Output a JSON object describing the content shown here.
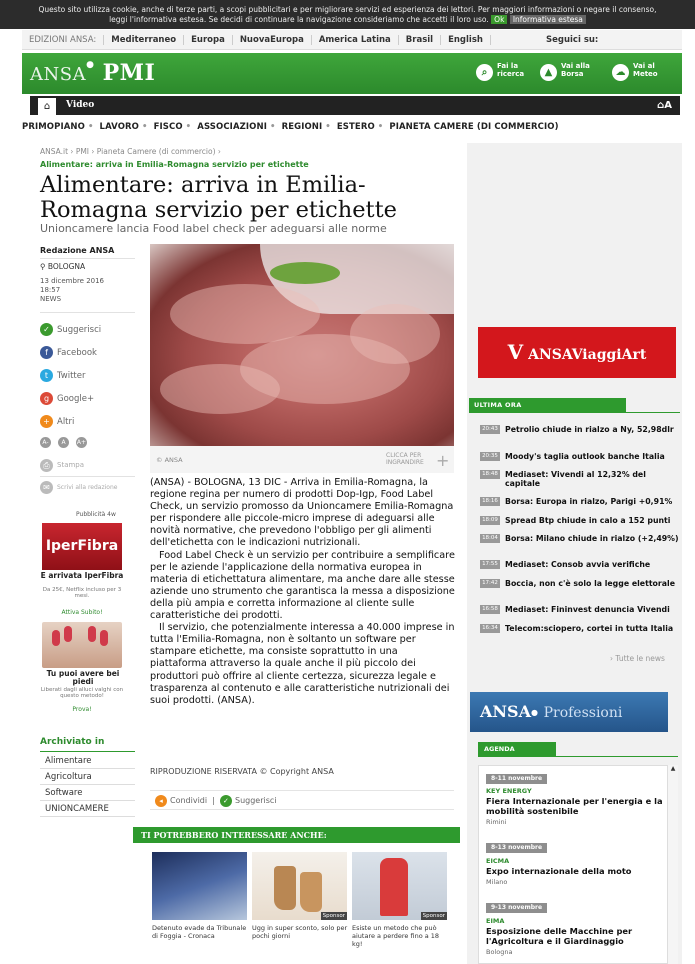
{
  "cookie": {
    "line1": "Questo sito utilizza cookie, anche di terze parti, a scopi pubblicitari e per migliorare servizi ed esperienza dei lettori. Per maggiori informazioni o negare il consenso,",
    "line2": "leggi l'informativa estesa. Se decidi di continuare la navigazione consideriamo che accetti il loro uso.",
    "ok": "Ok",
    "info": "Informativa estesa"
  },
  "editions": {
    "label": "EDIZIONI ANSA:",
    "items": [
      "Mediterraneo",
      "Europa",
      "NuovaEuropa",
      "America Latina",
      "Brasil",
      "English"
    ],
    "follow": "Seguici su:"
  },
  "header": {
    "logo_prefix": "ANSA",
    "logo_main": "PMI",
    "buttons": [
      {
        "icon": "search-icon",
        "label": "Fai la ricerca"
      },
      {
        "icon": "chart-icon",
        "label": "Vai alla Borsa"
      },
      {
        "icon": "weather-icon",
        "label": "Vai al Meteo"
      }
    ]
  },
  "nav": {
    "video": "Video",
    "font_size": "A"
  },
  "sections": [
    "PRIMOPIANO",
    "LAVORO",
    "FISCO",
    "ASSOCIAZIONI",
    "REGIONI",
    "ESTERO",
    "PIANETA CAMERE (DI COMMERCIO)"
  ],
  "article": {
    "breadcrumb": "ANSA.it › PMI › Pianeta Camere (di commercio) ›",
    "kicker": "Alimentare: arriva in Emilia-Romagna servizio per etichette",
    "title": "Alimentare: arriva in Emilia-Romagna servizio per etichette",
    "subtitle": "Unioncamere lancia Food label check per adeguarsi alle norme",
    "author": "Redazione ANSA",
    "location": "BOLOGNA",
    "date": "13 dicembre 2016",
    "time": "18:57",
    "type": "NEWS",
    "photo_credit": "© ANSA",
    "photo_enlarge": "CLICCA PER INGRANDIRE",
    "paragraphs": [
      "(ANSA) - BOLOGNA, 13 DIC - Arriva in Emilia-Romagna, la regione regina per numero di prodotti Dop-Igp, Food Label Check, un servizio promosso da Unioncamere Emilia-Romagna per rispondere alle piccole-micro imprese di adeguarsi alle novità normative, che prevedono l'obbligo per gli alimenti dell'etichetta con le indicazioni nutrizionali.",
      "Food Label Check è un servizio per contribuire a semplificare per le aziende l'applicazione della normativa europea in materia di etichettatura alimentare, ma anche dare alle stesse aziende uno strumento che garantisca la messa a disposizione della più ampia e corretta informazione al cliente sulle caratteristiche dei prodotti.",
      "Il servizio, che potenzialmente interessa a 40.000 imprese in tutta l'Emilia-Romagna, non è soltanto un software per stampare etichette, ma consiste soprattutto in una piattaforma attraverso la quale anche il più piccolo dei produttori può offrire al cliente certezza, sicurezza legale e trasparenza al contenuto e alle caratteristiche nutrizionali dei suoi prodotti. (ANSA)."
    ],
    "rights": "RIPRODUZIONE RISERVATA © Copyright ANSA",
    "share_label": "Condividi",
    "suggest_label": "Suggerisci"
  },
  "share": {
    "items": [
      {
        "icon": "suggest-icon",
        "label": "Suggerisci",
        "color": "#3b9a2e"
      },
      {
        "icon": "facebook-icon",
        "label": "Facebook",
        "color": "#3b5998"
      },
      {
        "icon": "twitter-icon",
        "label": "Twitter",
        "color": "#2aa9e0"
      },
      {
        "icon": "googleplus-icon",
        "label": "Google+",
        "color": "#dc4a38"
      },
      {
        "icon": "more-icon",
        "label": "Altri",
        "color": "#f08a1c"
      }
    ],
    "font_sizes": [
      "A-",
      "A",
      "A+"
    ],
    "print": "Stampa",
    "write": "Scrivi alla redazione"
  },
  "ads": {
    "label": "Pubblicità 4w",
    "ad1_brand": "IperFibra",
    "ad1_title": "E arrivata IperFibra",
    "ad1_sub": "Da 25€, Netflix incluso per 3 mesi.",
    "ad1_link": "Attiva Subito!",
    "ad2_title": "Tu puoi avere bei piedi",
    "ad2_sub": "Liberati dagli alluci valghi con questo metodo!",
    "ad2_link": "Prova!"
  },
  "archive": {
    "title": "Archiviato in",
    "items": [
      "Alimentare",
      "Agricoltura",
      "Software",
      "UNIONCAMERE"
    ]
  },
  "related": {
    "title": "TI POTREBBERO INTERESSARE ANCHE:",
    "items": [
      {
        "text": "Detenuto evade da Tribunale di Foggia - Cronaca",
        "sponsor": ""
      },
      {
        "text": "Ugg in super sconto, solo per pochi giorni",
        "sponsor": "Sponsor"
      },
      {
        "text": "Esiste un metodo che può aiutare a perdere fino a 18 kg!",
        "sponsor": "Sponsor"
      }
    ]
  },
  "sidebar": {
    "viaggiart": "ANSAViaggiArt",
    "ultima_title": "ULTIMA ORA",
    "news": [
      {
        "time": "20:43",
        "text": "Petrolio chiude in rialzo a Ny, 52,98dlr"
      },
      {
        "time": "20:35",
        "text": "Moody's taglia outlook banche Italia"
      },
      {
        "time": "18:48",
        "text": "Mediaset: Vivendi al 12,32% del capitale"
      },
      {
        "time": "18:16",
        "text": "Borsa: Europa in rialzo, Parigi +0,91%"
      },
      {
        "time": "18:09",
        "text": "Spread Btp chiude in calo a 152 punti"
      },
      {
        "time": "18:04",
        "text": "Borsa: Milano chiude in rialzo (+2,49%)"
      },
      {
        "time": "17:55",
        "text": "Mediaset: Consob avvia verifiche"
      },
      {
        "time": "17:42",
        "text": "Boccia, non c'è solo la legge elettorale"
      },
      {
        "time": "16:58",
        "text": "Mediaset: Fininvest denuncia Vivendi"
      },
      {
        "time": "16:34",
        "text": "Telecom:sciopero, cortei in tutta Italia"
      }
    ],
    "all_news": "› Tutte le news",
    "professioni_prefix": "ANSA",
    "professioni": "Professioni",
    "agenda_title": "AGENDA",
    "agenda": [
      {
        "date": "8-11 novembre",
        "tag": "KEY ENERGY",
        "title": "Fiera Internazionale per l'energia e la mobilità sostenibile",
        "place": "Rimini"
      },
      {
        "date": "8-13 novembre",
        "tag": "EICMA",
        "title": "Expo internazionale della moto",
        "place": "Milano"
      },
      {
        "date": "9-13 novembre",
        "tag": "EIMA",
        "title": "Esposizione delle Macchine per l'Agricoltura e il Giardinaggio",
        "place": "Bologna"
      }
    ]
  },
  "colors": {
    "green": "#2e9a2e",
    "header_green": "#3fa63b",
    "red": "#d3171c",
    "blue": "#3c79b3"
  }
}
